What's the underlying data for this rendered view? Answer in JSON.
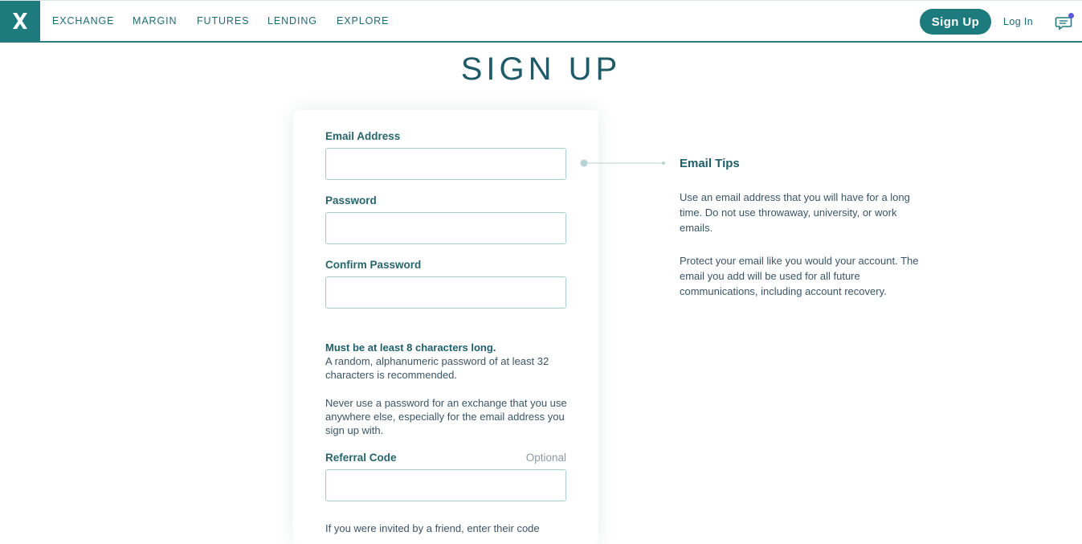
{
  "nav": {
    "logo": "X",
    "items": [
      "EXCHANGE",
      "MARGIN",
      "FUTURES",
      "LENDING",
      "EXPLORE"
    ],
    "signup_label": "Sign Up",
    "login_label": "Log In"
  },
  "page": {
    "title": "SIGN UP"
  },
  "form": {
    "email_label": "Email Address",
    "email_value": "",
    "password_label": "Password",
    "password_value": "",
    "confirm_label": "Confirm Password",
    "confirm_value": "",
    "rules_strong": "Must be at least 8 characters long.",
    "rules_text_1": "A random, alphanumeric password of at least 32 characters is recommended.",
    "rules_text_2": "Never use a password for an exchange that you use anywhere else, especially for the email address you sign up with.",
    "referral_label": "Referral Code",
    "referral_optional": "Optional",
    "referral_value": "",
    "referral_hint": "If you were invited by a friend, enter their code"
  },
  "tips": {
    "title": "Email Tips",
    "paragraph_1": "Use an email address that you will have for a long time. Do not use throwaway, university, or work emails.",
    "paragraph_2": "Protect your email like you would your account. The email you add will be used for all future communications, including account recovery."
  },
  "colors": {
    "brand": "#1d7b7d",
    "notification_dot": "#5b5bd6"
  }
}
